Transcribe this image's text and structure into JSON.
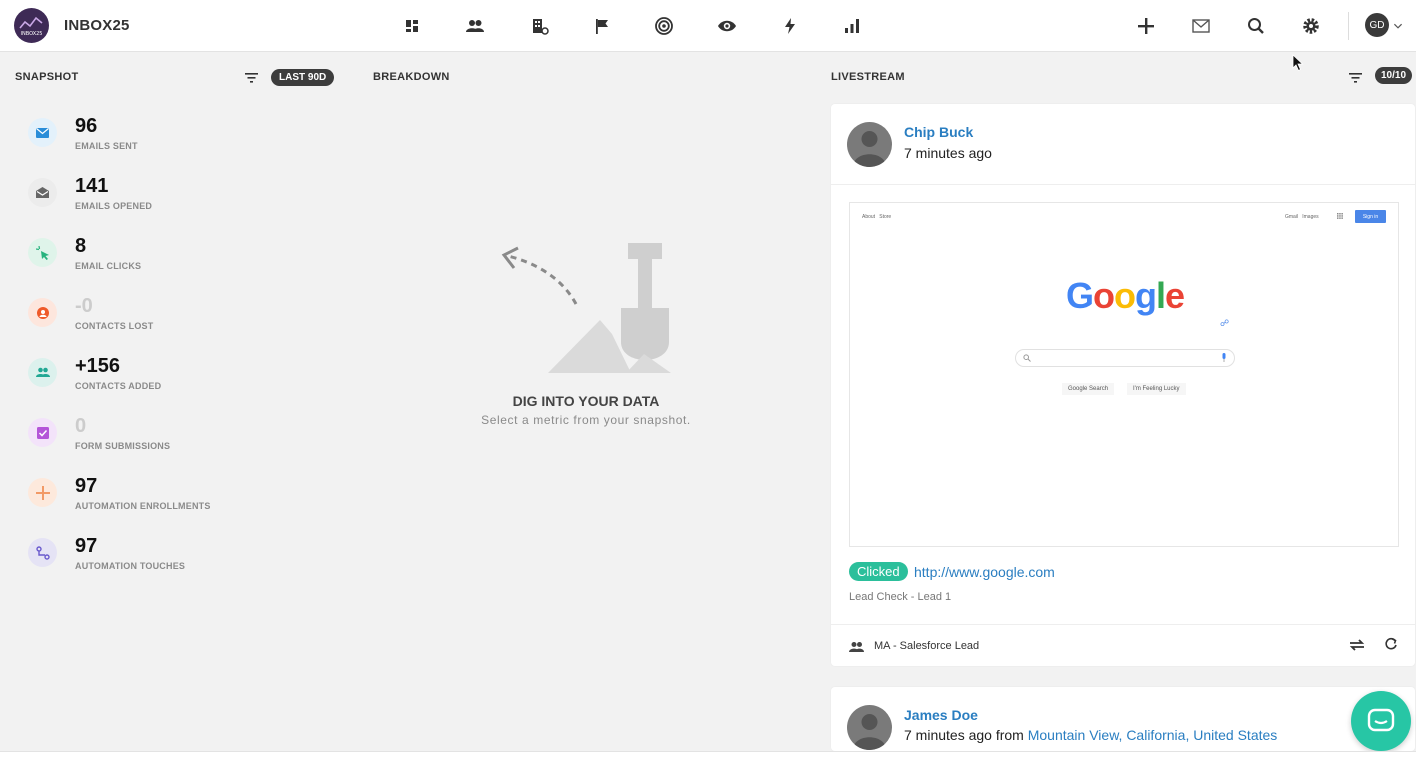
{
  "app": {
    "name": "INBOX25",
    "logo_text": "INBOX25",
    "user_initials": "GD"
  },
  "nav": {
    "icons": [
      "dashboard-icon",
      "contacts-icon",
      "companies-icon",
      "flag-icon",
      "target-icon",
      "eye-icon",
      "lightning-icon",
      "bar-chart-icon"
    ],
    "right_icons": [
      "plus-icon",
      "mail-icon",
      "search-icon",
      "gear-icon"
    ]
  },
  "snapshot": {
    "title": "SNAPSHOT",
    "range": "LAST 90D",
    "metrics": [
      {
        "value": "96",
        "label": "EMAILS SENT",
        "dim": false,
        "icon": "email-sent-icon",
        "color": "#2a8dd8",
        "bg": "#e3f1fb"
      },
      {
        "value": "141",
        "label": "EMAILS OPENED",
        "dim": false,
        "icon": "email-opened-icon",
        "color": "#666666",
        "bg": "#ececec"
      },
      {
        "value": "8",
        "label": "EMAIL CLICKS",
        "dim": false,
        "icon": "click-icon",
        "color": "#27b37e",
        "bg": "#dff4ea"
      },
      {
        "value": "-0",
        "label": "CONTACTS LOST",
        "dim": true,
        "icon": "contacts-lost-icon",
        "color": "#ef5a2a",
        "bg": "#fde6dd"
      },
      {
        "value": "+156",
        "label": "CONTACTS ADDED",
        "dim": false,
        "icon": "contacts-added-icon",
        "color": "#22a894",
        "bg": "#dcf1ed"
      },
      {
        "value": "0",
        "label": "FORM SUBMISSIONS",
        "dim": true,
        "icon": "form-icon",
        "color": "#b455d8",
        "bg": "#f3e3fa"
      },
      {
        "value": "97",
        "label": "AUTOMATION ENROLLMENTS",
        "dim": false,
        "icon": "plus-icon",
        "color": "#f29a66",
        "bg": "#fde9dc"
      },
      {
        "value": "97",
        "label": "AUTOMATION TOUCHES",
        "dim": false,
        "icon": "automation-icon",
        "color": "#6a5acd",
        "bg": "#e5e3f5"
      }
    ]
  },
  "breakdown": {
    "title": "BREAKDOWN",
    "empty_title": "DIG INTO YOUR DATA",
    "empty_subtitle": "Select a metric from your snapshot."
  },
  "livestream": {
    "title": "LIVESTREAM",
    "count": "10/10",
    "items": [
      {
        "name": "Chip Buck",
        "time": "7 minutes ago",
        "badge": "Clicked",
        "url": "http://www.google.com",
        "sublabel": "Lead Check - Lead 1",
        "footer": "MA - Salesforce Lead",
        "preview": {
          "nav_left": [
            "About",
            "Store"
          ],
          "nav_right": [
            "Gmail",
            "Images"
          ],
          "sign_in": "Sign in",
          "logo": "Google",
          "buttons": [
            "Google Search",
            "I'm Feeling Lucky"
          ]
        }
      },
      {
        "name": "James Doe",
        "time": "7 minutes ago",
        "from": "from",
        "location": "Mountain View, California, United States"
      }
    ]
  }
}
